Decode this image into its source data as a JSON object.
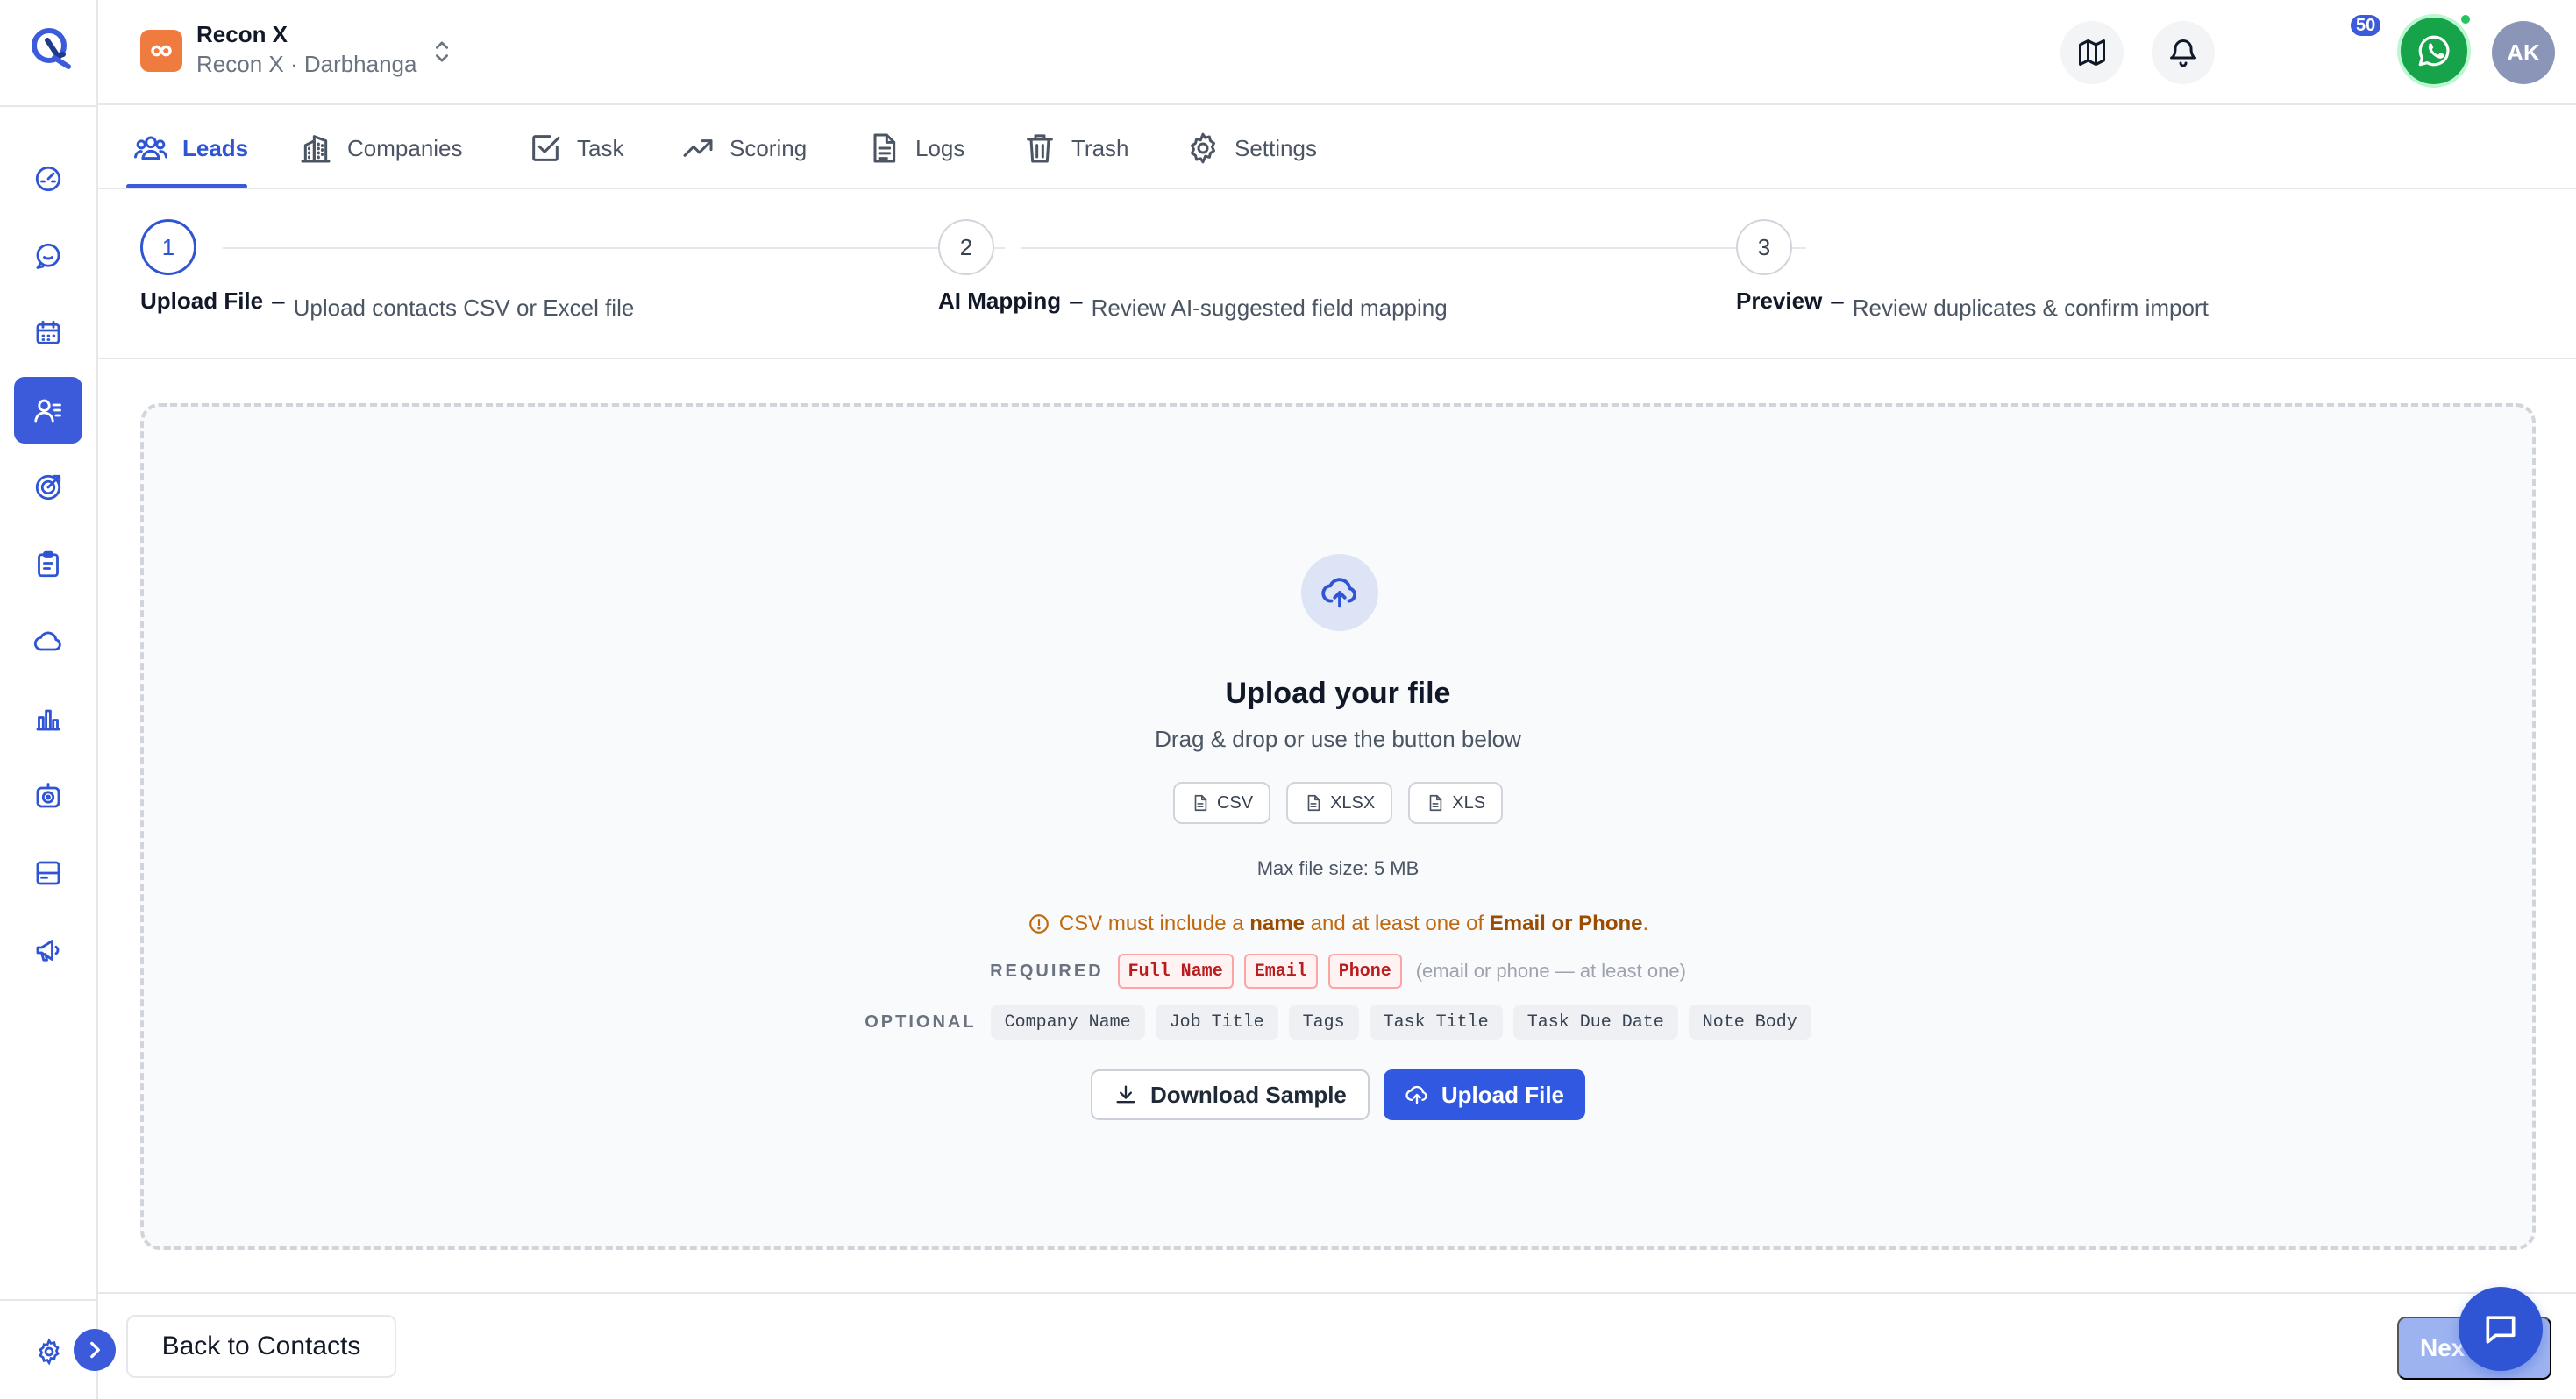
{
  "colors": {
    "accent": "#3b5bdb",
    "brand_tile": "#f07b3f",
    "whatsapp": "#16a34a",
    "warning": "#c2670a",
    "required_chip": "#b91c1c"
  },
  "rail": {
    "items": [
      {
        "name": "dashboard-icon"
      },
      {
        "name": "chat-icon"
      },
      {
        "name": "calendar-icon"
      },
      {
        "name": "contacts-icon",
        "active": true
      },
      {
        "name": "target-icon"
      },
      {
        "name": "clipboard-icon"
      },
      {
        "name": "cloud-icon"
      },
      {
        "name": "bar-chart-icon"
      },
      {
        "name": "camera-icon"
      },
      {
        "name": "card-icon"
      },
      {
        "name": "megaphone-icon"
      }
    ]
  },
  "header": {
    "brand_name": "Recon X",
    "brand_sub": "Recon X · Darbhanga",
    "notification_count": "50",
    "avatar_initials": "AK"
  },
  "tabs": [
    {
      "label": "Leads",
      "icon": "users-icon",
      "active": true
    },
    {
      "label": "Companies",
      "icon": "building-icon"
    },
    {
      "label": "Task",
      "icon": "checkbox-icon"
    },
    {
      "label": "Scoring",
      "icon": "trending-up-icon"
    },
    {
      "label": "Logs",
      "icon": "document-icon"
    },
    {
      "label": "Trash",
      "icon": "trash-icon"
    },
    {
      "label": "Settings",
      "icon": "gear-icon"
    }
  ],
  "steps": [
    {
      "number": "1",
      "title": "Upload File",
      "dash": "–",
      "description": "Upload contacts CSV or Excel file",
      "active": true
    },
    {
      "number": "2",
      "title": "AI Mapping",
      "dash": "–",
      "description": "Review AI-suggested field mapping"
    },
    {
      "number": "3",
      "title": "Preview",
      "dash": "–",
      "description": "Review duplicates & confirm import"
    }
  ],
  "upload": {
    "title": "Upload your file",
    "subtitle": "Drag & drop or use the button below",
    "formats": [
      "CSV",
      "XLSX",
      "XLS"
    ],
    "max_size": "Max file size: 5 MB",
    "warning": {
      "part1": "CSV must include a ",
      "bold1": "name",
      "part2": " and at least one of ",
      "bold2": "Email or Phone",
      "part3": "."
    },
    "required_label": "REQUIRED",
    "required_fields": [
      "Full Name",
      "Email",
      "Phone"
    ],
    "required_note": "(email or phone — at least one)",
    "optional_label": "OPTIONAL",
    "optional_fields": [
      "Company Name",
      "Job Title",
      "Tags",
      "Task Title",
      "Task Due Date",
      "Note Body"
    ],
    "download_label": "Download Sample",
    "upload_label": "Upload File"
  },
  "footer": {
    "back_label": "Back to Contacts",
    "next_label": "Next"
  }
}
